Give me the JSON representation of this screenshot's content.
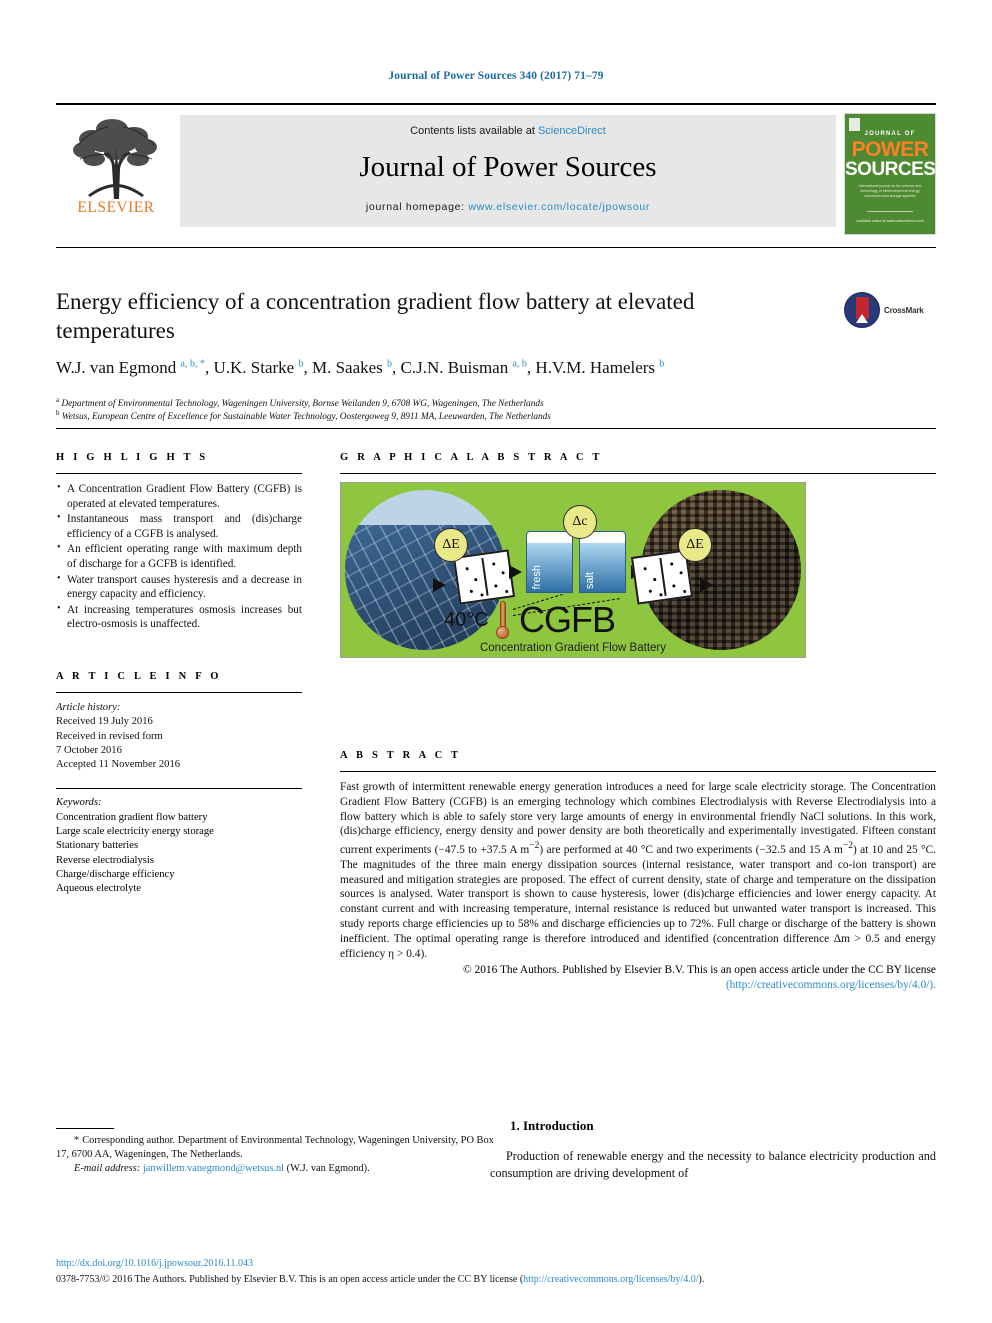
{
  "running_head": "Journal of Power Sources 340 (2017) 71–79",
  "masthead": {
    "contents_prefix": "Contents lists available at ",
    "sciencedirect": "ScienceDirect",
    "journal_title": "Journal of Power Sources",
    "homepage_label": "journal homepage: ",
    "homepage_url": "www.elsevier.com/locate/jpowsour",
    "publisher": "ELSEVIER",
    "cover": {
      "line1": "JOURNAL OF",
      "line2": "POWER",
      "line3": "SOURCES",
      "subtitle": "International journal on the science and technology of electrochemical energy conversion and storage systems",
      "footer": "Available online at www.sciencedirect.com"
    },
    "accent_blue": "#2b8bc6",
    "elsevier_orange": "#e87722",
    "cover_green": "#4e8a32"
  },
  "article": {
    "title": "Energy efficiency of a concentration gradient flow battery at elevated temperatures",
    "crossmark_label": "CrossMark",
    "authors_html": "W.J. van Egmond <sup>a, b, *</sup>, U.K. Starke <sup>b</sup>, M. Saakes <sup>b</sup>, C.J.N. Buisman <sup>a, b</sup>, H.V.M. Hamelers <sup>b</sup>",
    "affiliation_a": "Department of Environmental Technology, Wageningen University, Bornse Weilanden 9, 6708 WG, Wageningen, The Netherlands",
    "affiliation_b": "Wetsus, European Centre of Excellence for Sustainable Water Technology, Oostergoweg 9, 8911 MA, Leeuwarden, The Netherlands"
  },
  "highlights": {
    "heading": "H I G H L I G H T S",
    "items": [
      "A Concentration Gradient Flow Battery (CGFB) is operated at elevated temperatures.",
      "Instantaneous mass transport and (dis)charge efficiency of a CGFB is analysed.",
      "An efficient operating range with maximum depth of discharge for a GCFB is identified.",
      "Water transport causes hysteresis and a decrease in energy capacity and efficiency.",
      "At increasing temperatures osmosis increases but electro-osmosis is unaffected."
    ]
  },
  "graphical_abstract": {
    "heading": "G R A P H I C A L   A B S T R A C T",
    "badge_left": "ΔE",
    "badge_center": "Δc",
    "badge_right": "ΔE",
    "tank_fresh": "fresh",
    "tank_salt": "salt",
    "temperature": "40°C",
    "acronym": "CGFB",
    "caption": "Concentration Gradient Flow Battery",
    "background_color": "#8ec63f"
  },
  "article_info": {
    "heading": "A R T I C L E   I N F O",
    "history_label": "Article history:",
    "received": "Received 19 July 2016",
    "revised_label": "Received in revised form",
    "revised_date": "7 October 2016",
    "accepted": "Accepted 11 November 2016",
    "keywords_label": "Keywords:",
    "keywords": [
      "Concentration gradient flow battery",
      "Large scale electricity energy storage",
      "Stationary batteries",
      "Reverse electrodialysis",
      "Charge/discharge efficiency",
      "Aqueous electrolyte"
    ]
  },
  "abstract": {
    "heading": "A B S T R A C T",
    "body_html": "Fast growth of intermittent renewable energy generation introduces a need for large scale electricity storage. The Concentration Gradient Flow Battery (CGFB) is an emerging technology which combines Electrodialysis with Reverse Electrodialysis into a flow battery which is able to safely store very large amounts of energy in environmental friendly NaCl solutions. In this work, (dis)charge efficiency, energy density and power density are both theoretically and experimentally investigated. Fifteen constant current experiments (−47.5 to +37.5 A m<sup>−2</sup>) are performed at 40 °C and two experiments (−32.5 and 15 A m<sup>−2</sup>) at 10 and 25 °C. The magnitudes of the three main energy dissipation sources (internal resistance, water transport and co-ion transport) are measured and mitigation strategies are proposed. The effect of current density, state of charge and temperature on the dissipation sources is analysed. Water transport is shown to cause hysteresis, lower (dis)charge efficiencies and lower energy capacity. At constant current and with increasing temperature, internal resistance is reduced but unwanted water transport is increased. This study reports charge efficiencies up to 58% and discharge efficiencies up to 72%. Full charge or discharge of the battery is shown inefficient. The optimal operating range is therefore introduced and identified (concentration difference Δm &gt; 0.5 and energy efficiency η &gt; 0.4).",
    "copyright_text": "© 2016 The Authors. Published by Elsevier B.V. This is an open access article under the CC BY license",
    "license_url": "(http://creativecommons.org/licenses/by/4.0/)."
  },
  "introduction": {
    "heading": "1. Introduction",
    "paragraph": "Production of renewable energy and the necessity to balance electricity production and consumption are driving development of"
  },
  "footnote": {
    "marker": "*",
    "corresponding": "Corresponding author. Department of Environmental Technology, Wageningen University, PO Box 17, 6700 AA, Wageningen, The Netherlands.",
    "email_label": "E-mail address:",
    "email": "janwillem.vanegmond@wetsus.nl",
    "email_suffix": "(W.J. van Egmond)."
  },
  "page_footer": {
    "doi": "http://dx.doi.org/10.1016/j.jpowsour.2016.11.043",
    "issn_copyright": "0378-7753/© 2016 The Authors. Published by Elsevier B.V. This is an open access article under the CC BY license (",
    "license_link": "http://creativecommons.org/licenses/by/4.0/",
    "issn_tail": ")."
  }
}
